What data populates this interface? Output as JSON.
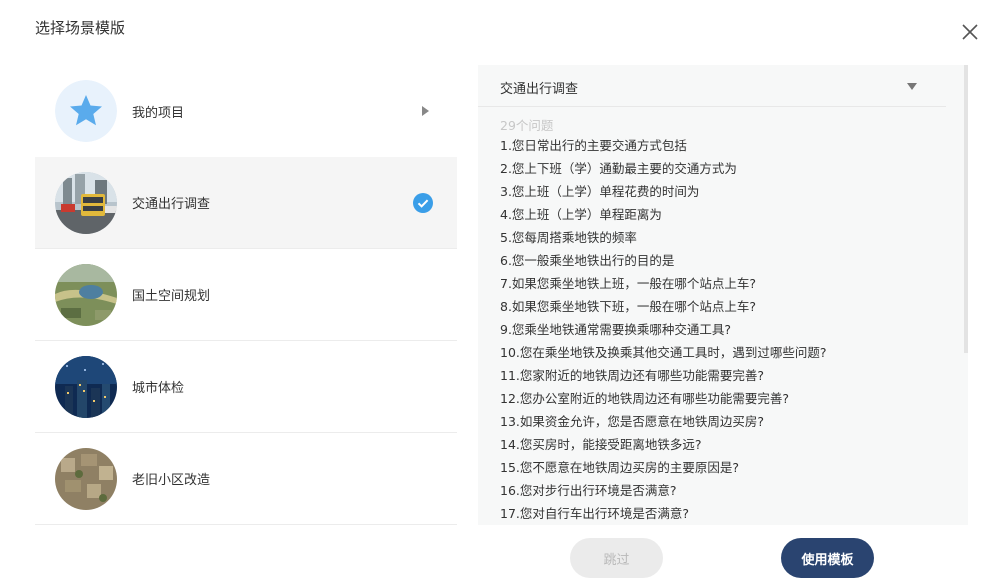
{
  "dialog": {
    "title": "选择场景模版",
    "close_icon": "close-icon"
  },
  "scenes": [
    {
      "label": "我的项目",
      "icon": "star-icon"
    },
    {
      "label": "交通出行调查",
      "selected": true
    },
    {
      "label": "国土空间规划"
    },
    {
      "label": "城市体检"
    },
    {
      "label": "老旧小区改造"
    }
  ],
  "detail": {
    "selected_scene": "交通出行调查",
    "question_count": "29个问题",
    "questions": [
      "1.您日常出行的主要交通方式包括",
      "2.您上下班（学）通勤最主要的交通方式为",
      "3.您上班（上学）单程花费的时间为",
      "4.您上班（上学）单程距离为",
      "5.您每周搭乘地铁的频率",
      "6.您一般乘坐地铁出行的目的是",
      "7.如果您乘坐地铁上班，一般在哪个站点上车?",
      "8.如果您乘坐地铁下班，一般在哪个站点上车?",
      "9.您乘坐地铁通常需要换乘哪种交通工具?",
      "10.您在乘坐地铁及换乘其他交通工具时，遇到过哪些问题?",
      "11.您家附近的地铁周边还有哪些功能需要完善?",
      "12.您办公室附近的地铁周边还有哪些功能需要完善?",
      "13.如果资金允许，您是否愿意在地铁周边买房?",
      "14.您买房时，能接受距离地铁多远?",
      "15.您不愿意在地铁周边买房的主要原因是?",
      "16.您对步行出行环境是否满意?",
      "17.您对自行车出行环境是否满意?"
    ]
  },
  "footer": {
    "skip_label": "跳过",
    "use_label": "使用模板"
  },
  "colors": {
    "accent": "#2a4470",
    "check": "#3a9ee8",
    "star": "#5aabec"
  }
}
